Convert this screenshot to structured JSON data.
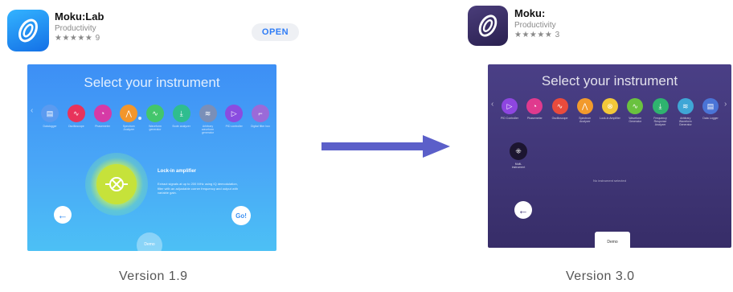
{
  "left_app": {
    "name": "Moku:Lab",
    "category": "Productivity",
    "rating_stars": "★★★★★",
    "rating_count": "9",
    "open_label": "OPEN"
  },
  "right_app": {
    "name": "Moku:",
    "category": "Productivity",
    "rating_stars": "★★★★★",
    "rating_count": "3"
  },
  "v1_screen": {
    "title": "Select your instrument",
    "instruments": [
      {
        "label": "Datalogger",
        "color": "#5b9bf0",
        "icon": "data-logger-icon",
        "glyph": "▤"
      },
      {
        "label": "Oscilloscope",
        "color": "#e8335b",
        "icon": "oscilloscope-icon",
        "glyph": "∿"
      },
      {
        "label": "Phasemeter",
        "color": "#d63aa6",
        "icon": "phasemeter-icon",
        "glyph": "◔"
      },
      {
        "label": "Spectrum Analyzer",
        "color": "#f2962c",
        "icon": "spectrum-icon",
        "glyph": "⋀"
      },
      {
        "label": "Waveform generator",
        "color": "#43c66c",
        "icon": "waveform-icon",
        "glyph": "∿"
      },
      {
        "label": "Bode analyzer",
        "color": "#2fbd8f",
        "icon": "bode-icon",
        "glyph": "⤓"
      },
      {
        "label": "Arbitrary waveform generator",
        "color": "#7a8fb8",
        "icon": "arbitrary-waveform-icon",
        "glyph": "≋"
      },
      {
        "label": "PID controller",
        "color": "#8a4ce0",
        "icon": "pid-icon",
        "glyph": "▷"
      },
      {
        "label": "Digital filter box",
        "color": "#9b6ad8",
        "icon": "filter-icon",
        "glyph": "⌐"
      }
    ],
    "selected_name": "Lock-in amplifier",
    "selected_desc": "Extract signals at up to 200 MHz using IQ demodulation, filter with an adjustable corner frequency and output with variable gain.",
    "go_label": "Go!",
    "demo_label": "Demo"
  },
  "v3_screen": {
    "title": "Select your instrument",
    "instruments": [
      {
        "label": "PID Controller",
        "color": "#8e46e0",
        "icon": "pid-icon",
        "glyph": "▷"
      },
      {
        "label": "Phasemeter",
        "color": "#e03a8e",
        "icon": "phasemeter-icon",
        "glyph": "◔"
      },
      {
        "label": "Oscilloscope",
        "color": "#ea4b3c",
        "icon": "oscilloscope-icon",
        "glyph": "∿"
      },
      {
        "label": "Spectrum Analyzer",
        "color": "#f29a2c",
        "icon": "spectrum-icon",
        "glyph": "⋀"
      },
      {
        "label": "Lock-in Amplifier",
        "color": "#f3c83a",
        "icon": "lock-in-icon",
        "glyph": "⊗"
      },
      {
        "label": "Waveform Generator",
        "color": "#6ac23f",
        "icon": "waveform-icon",
        "glyph": "∿"
      },
      {
        "label": "Frequency Response Analyzer",
        "color": "#2fb36f",
        "icon": "frequency-response-icon",
        "glyph": "⤓"
      },
      {
        "label": "Arbitrary Waveform Generator",
        "color": "#3fa6d6",
        "icon": "arbitrary-waveform-icon",
        "glyph": "≋"
      },
      {
        "label": "Data Logger",
        "color": "#4a74d6",
        "icon": "data-logger-icon",
        "glyph": "▤"
      }
    ],
    "multi_label": "Multi-instrument",
    "status": "No instrument selected",
    "demo_label": "Demo"
  },
  "labels": {
    "left_version": "Version 1.9",
    "right_version": "Version 3.0"
  }
}
